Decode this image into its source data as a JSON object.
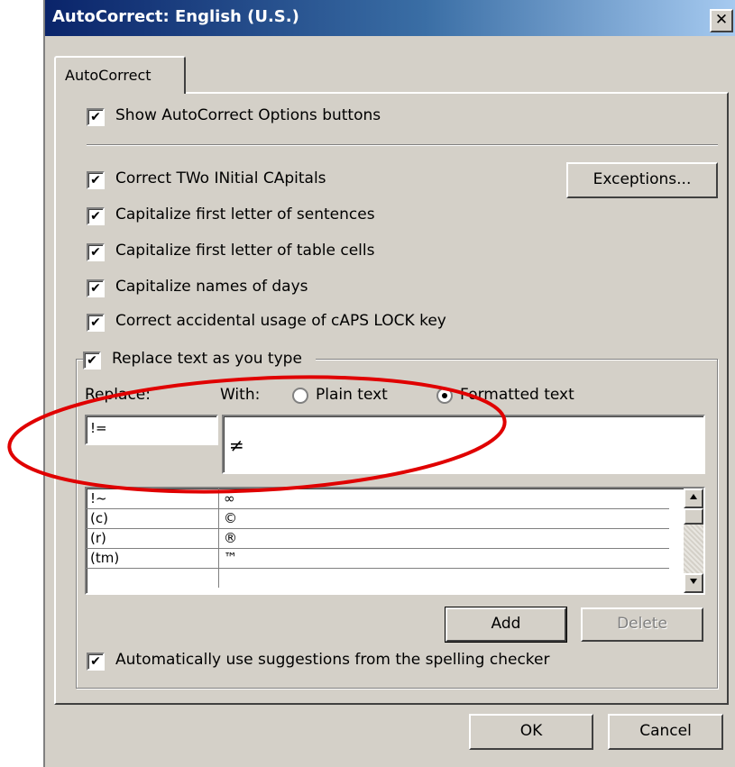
{
  "window": {
    "title": "AutoCorrect: English (U.S.)",
    "close_glyph": "✕"
  },
  "tabs": [
    {
      "label": "AutoCorrect"
    }
  ],
  "options": {
    "show_buttons": {
      "label": "Show AutoCorrect Options buttons",
      "checked": true
    },
    "two_initials": {
      "label": "Correct TWo INitial CApitals",
      "checked": true
    },
    "first_letter_sentences": {
      "label": "Capitalize first letter of sentences",
      "checked": true
    },
    "first_letter_cells": {
      "label": "Capitalize first letter of table cells",
      "checked": true
    },
    "names_days": {
      "label": "Capitalize names of days",
      "checked": true
    },
    "caps_lock": {
      "label": "Correct accidental usage of cAPS LOCK key",
      "checked": true
    },
    "replace_text": {
      "label": "Replace text as you type",
      "checked": true
    },
    "spelling": {
      "label": "Automatically use suggestions from the spelling checker",
      "checked": true
    }
  },
  "buttons": {
    "exceptions": "Exceptions...",
    "add": "Add",
    "delete": "Delete",
    "ok": "OK",
    "cancel": "Cancel"
  },
  "replace_section": {
    "replace_label": "Replace:",
    "with_label": "With:",
    "plain_text_label": "Plain text",
    "formatted_text_label": "Formatted text",
    "selected_mode": "formatted",
    "replace_value": "!=",
    "with_value": "≠"
  },
  "list": {
    "rows": [
      {
        "replace": "!~",
        "with": "∞"
      },
      {
        "replace": "(c)",
        "with": "©"
      },
      {
        "replace": "(r)",
        "with": "®"
      },
      {
        "replace": "(tm)",
        "with": "™"
      }
    ]
  },
  "check_glyph": "✔",
  "annotation_color": "#e00000"
}
